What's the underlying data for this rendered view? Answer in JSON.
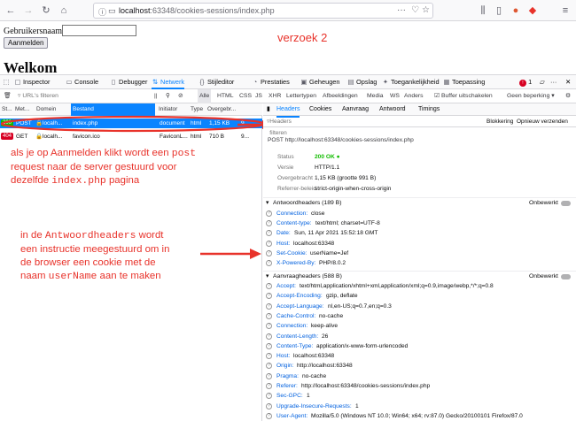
{
  "browser": {
    "url_host": "localhost",
    "url_path": ":63348/cookies-sessions/index.php",
    "icons": [
      "back-icon",
      "forward-icon",
      "reload-icon",
      "home-icon",
      "page-info-icon",
      "more-icon",
      "bookmark-star-icon",
      "library-icon",
      "sidebar-icon",
      "duckduckgo-icon",
      "extension-icon",
      "menu-icon"
    ],
    "badge_count": "1"
  },
  "page": {
    "label": "Gebruikersnaam:",
    "button": "Aanmelden",
    "heading": "Welkom",
    "annotation_top": "verzoek 2"
  },
  "devtools": {
    "tabs": [
      "Inspector",
      "Console",
      "Debugger",
      "Netwerk",
      "Stijleditor",
      "Prestaties",
      "Geheugen",
      "Opslag",
      "Toegankelijkheid",
      "Toepassing"
    ],
    "active_tab": "Netwerk",
    "error_badge": "1",
    "filter_placeholder": "URL's filteren",
    "type_filters": [
      "Alle",
      "HTML",
      "CSS",
      "JS",
      "XHR",
      "Lettertypen",
      "Afbeeldingen",
      "Media",
      "WS",
      "Anders"
    ],
    "cache_label": "Buffer uitschakelen",
    "throttle_label": "Geen beperking",
    "columns": [
      "St...",
      "Met...",
      "Domein",
      "Bestand",
      "Initiator",
      "Type",
      "Overgebr..."
    ],
    "requests": [
      {
        "status": "200",
        "method": "POST",
        "domain": "localh...",
        "file": "index.php",
        "initiator": "document",
        "type": "html",
        "size": "1,15 KB",
        "time": "9..."
      },
      {
        "status": "404",
        "method": "GET",
        "domain": "localh...",
        "file": "favicon.ico",
        "initiator": "FaviconL...",
        "type": "html",
        "size": "710 B",
        "time": "9..."
      }
    ]
  },
  "details": {
    "tabs": [
      "Headers",
      "Cookies",
      "Aanvraag",
      "Antwoord",
      "Timings"
    ],
    "filter_placeholder": "Headers filteren",
    "block_label": "Blokkering",
    "resend_label": "Opnieuw verzenden",
    "request_line": "POST http://localhost:63348/cookies-sessions/index.php",
    "summary": [
      {
        "k": "Status",
        "v": "200 OK"
      },
      {
        "k": "Versie",
        "v": "HTTP/1.1"
      },
      {
        "k": "Overgebracht",
        "v": "1,15 KB (grootte 991 B)"
      },
      {
        "k": "Referrer-beleid",
        "v": "strict-origin-when-cross-origin"
      }
    ],
    "response_title": "Antwoordheaders (189 B)",
    "raw_label": "Onbewerkt",
    "response_headers": [
      {
        "k": "Connection:",
        "v": "close"
      },
      {
        "k": "Content-type:",
        "v": "text/html; charset=UTF-8"
      },
      {
        "k": "Date:",
        "v": "Sun, 11 Apr 2021 15:52:18 GMT"
      },
      {
        "k": "Host:",
        "v": "localhost:63348"
      },
      {
        "k": "Set-Cookie:",
        "v": "userName=Jef"
      },
      {
        "k": "X-Powered-By:",
        "v": "PHP/8.0.2"
      }
    ],
    "request_title": "Aanvraagheaders (588 B)",
    "request_headers": [
      {
        "k": "Accept:",
        "v": "text/html,application/xhtml+xml,application/xml;q=0.9,image/webp,*/*;q=0.8"
      },
      {
        "k": "Accept-Encoding:",
        "v": "gzip, deflate"
      },
      {
        "k": "Accept-Language:",
        "v": "nl,en-US;q=0.7,en;q=0.3"
      },
      {
        "k": "Cache-Control:",
        "v": "no-cache"
      },
      {
        "k": "Connection:",
        "v": "keep-alive"
      },
      {
        "k": "Content-Length:",
        "v": "26"
      },
      {
        "k": "Content-Type:",
        "v": "application/x-www-form-urlencoded"
      },
      {
        "k": "Host:",
        "v": "localhost:63348"
      },
      {
        "k": "Origin:",
        "v": "http://localhost:63348"
      },
      {
        "k": "Pragma:",
        "v": "no-cache"
      },
      {
        "k": "Referer:",
        "v": "http://localhost:63348/cookies-sessions/index.php"
      },
      {
        "k": "Sec-GPC:",
        "v": "1"
      },
      {
        "k": "Upgrade-Insecure-Requests:",
        "v": "1"
      },
      {
        "k": "User-Agent:",
        "v": "Mozilla/5.0 (Windows NT 10.0; Win64; x64; rv:87.0) Gecko/20100101 Firefox/87.0"
      }
    ]
  },
  "annotations": {
    "a1_l1": "als je op Aanmelden klikt wordt een",
    "a1_l1_code": "post",
    "a1_l2": "request naar de server gestuurd voor",
    "a1_l3_pre": "dezelfde",
    "a1_l3_code": "index.php",
    "a1_l3_post": "pagina",
    "a2_l1_pre": "in de",
    "a2_l1_code": "Antwoordheaders",
    "a2_l1_post": "wordt",
    "a2_l2": "een instructie meegestuurd om in",
    "a2_l3": "de browser een cookie met de",
    "a2_l4_pre": "naam",
    "a2_l4_code": "userName",
    "a2_l4_post": "aan te maken"
  },
  "colors": {
    "accent": "#0a84ff",
    "annotation": "#e8322a",
    "ok": "#12bc00"
  }
}
